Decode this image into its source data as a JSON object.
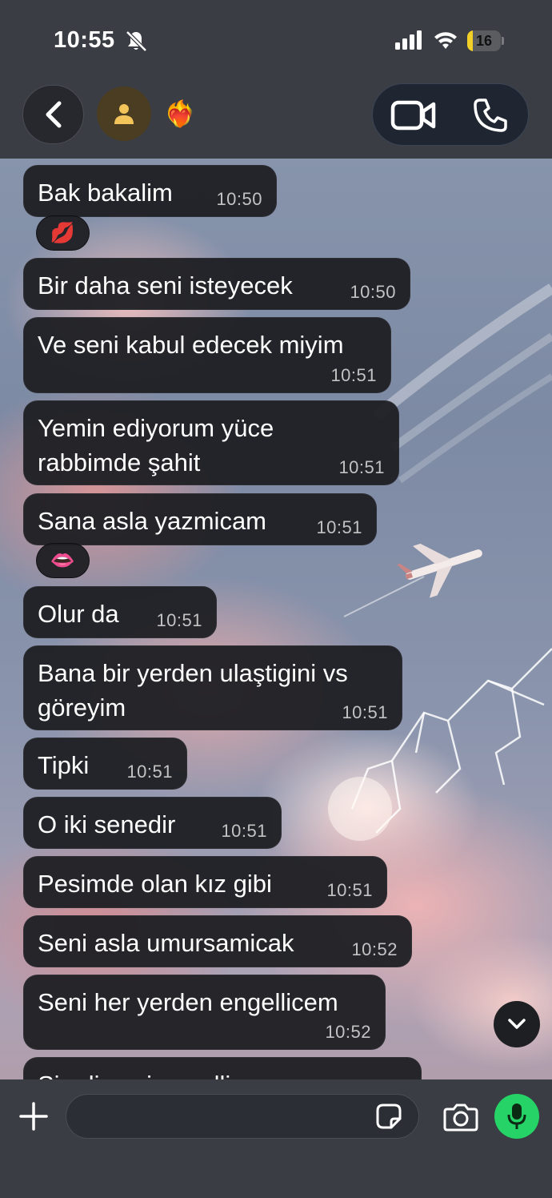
{
  "status_bar": {
    "time": "10:55",
    "battery_level": "16",
    "battery_fraction": 0.16,
    "icons": [
      "bell-slash-icon",
      "signal-icon",
      "wifi-icon",
      "battery-icon"
    ]
  },
  "header": {
    "contact_emoji": "❤️‍🔥",
    "icons": [
      "chevron-left-icon",
      "person-icon",
      "video-camera-icon",
      "phone-icon"
    ]
  },
  "messages": [
    {
      "text": "Bak bakalim",
      "time": "10:50"
    },
    {
      "text": "Bir daha seni isteyecek",
      "time": "10:50"
    },
    {
      "text": "Ve seni kabul edecek miyim",
      "time": "10:51"
    },
    {
      "text": "Yemin ediyorum yüce\nrabbimde şahit",
      "time": "10:51"
    },
    {
      "text": "Sana asla yazmicam",
      "time": "10:51"
    },
    {
      "text": "Olur da",
      "time": "10:51"
    },
    {
      "text": "Bana bir yerden ulaştigini vs\ngöreyim",
      "time": "10:51"
    },
    {
      "text": "Tipki",
      "time": "10:51"
    },
    {
      "text": "O iki senedir",
      "time": "10:51"
    },
    {
      "text": "Pesimde olan kız gibi",
      "time": "10:51"
    },
    {
      "text": "Seni asla umursamicak",
      "time": "10:52"
    },
    {
      "text": "Seni her yerden engellicem",
      "time": "10:52"
    },
    {
      "text": "Simdi seni engelliyorum",
      "time": ""
    }
  ],
  "reactions": [
    {
      "emoji": "💋",
      "after_message": 0
    },
    {
      "emoji": "👄",
      "after_message": 4
    }
  ],
  "composer": {
    "input_value": "",
    "placeholder": "",
    "icons": [
      "plus-icon",
      "sticker-icon",
      "camera-icon",
      "microphone-icon"
    ],
    "mic_color": "#25d366"
  },
  "colors": {
    "bars": "#3a3d44",
    "bubble": "#1e1f23",
    "battery": "#f2d027"
  }
}
